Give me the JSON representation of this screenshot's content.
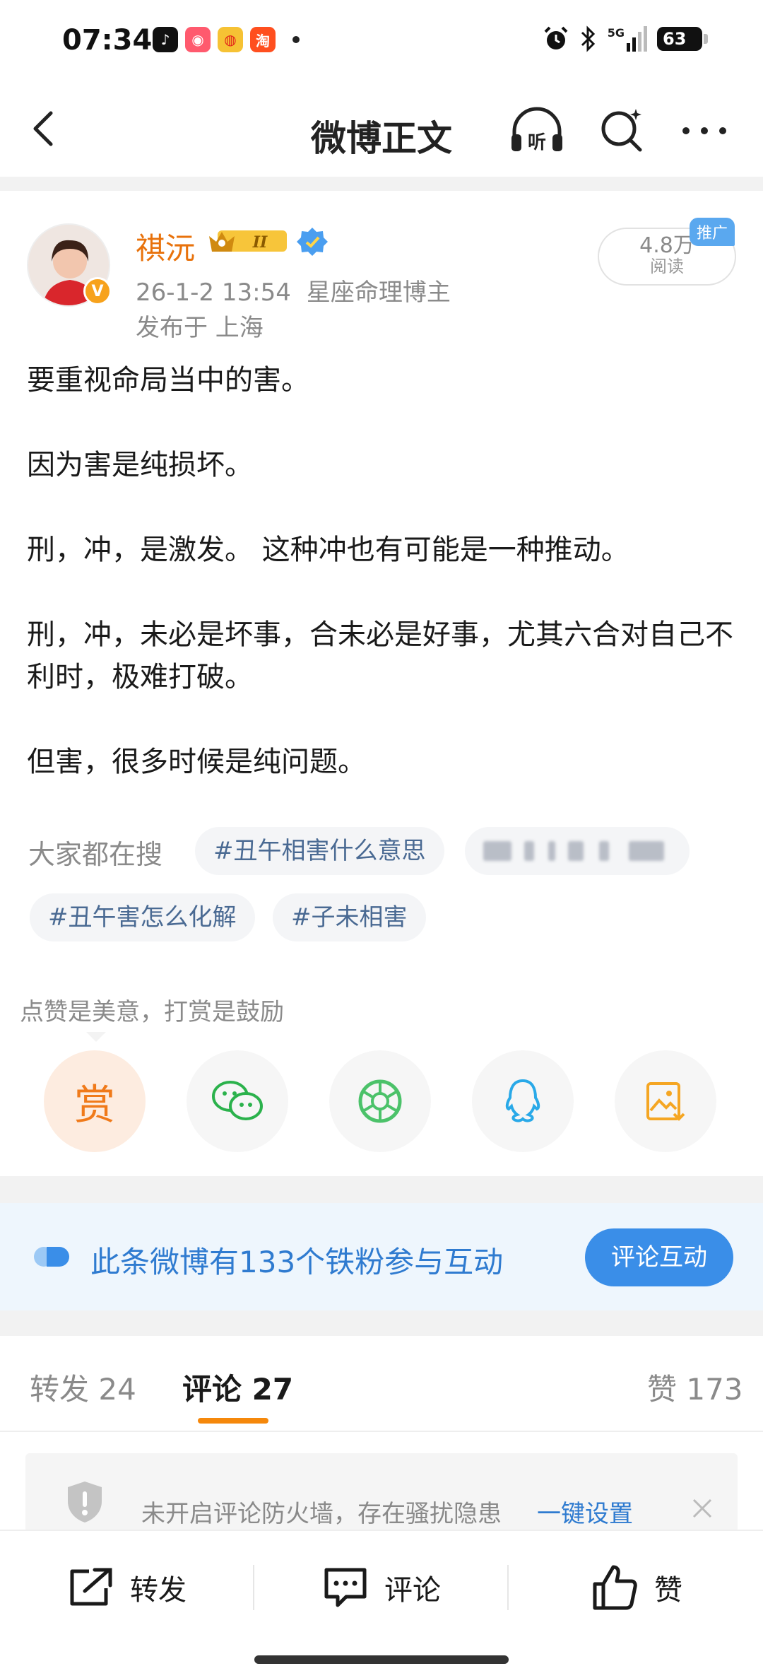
{
  "status_bar": {
    "time": "07:34",
    "network": "5G",
    "battery": "63",
    "app_icons": [
      "douyin-icon",
      "app-icon",
      "weibo-icon",
      "taobao-icon"
    ]
  },
  "nav": {
    "title": "微博正文",
    "listen_label": "听"
  },
  "post": {
    "author": "祺沅",
    "vip_level": "II",
    "date": "26-1-2 13:54",
    "source": "星座命理博主",
    "location": "发布于 上海",
    "read_count": "4.8万",
    "read_label": "阅读",
    "promo_tag": "推广",
    "paragraphs": [
      "要重视命局当中的害。",
      "因为害是纯损坏。",
      "刑，冲，是激发。 这种冲也有可能是一种推动。",
      "刑，冲，未必是坏事，合未必是好事，尤其六合对自己不利时，极难打破。",
      "但害，很多时候是纯问题。"
    ]
  },
  "hot_search": {
    "label": "大家都在搜",
    "tags": [
      "#丑午相害什么意思",
      "#丑午害怎么化解",
      "#子未相害"
    ]
  },
  "reward": {
    "hint": "点赞是美意，打赏是鼓励",
    "reward_label": "赏",
    "share_targets": [
      "wechat-icon",
      "moments-icon",
      "qq-icon",
      "save-image-icon"
    ]
  },
  "fans": {
    "text": "此条微博有133个铁粉参与互动",
    "button": "评论互动"
  },
  "tabs": {
    "repost": "转发 24",
    "comment": "评论 27",
    "like": "赞 173"
  },
  "firewall": {
    "text": "未开启评论防火墙，存在骚扰隐患",
    "link": "一键设置"
  },
  "bottom_bar": {
    "repost": "转发",
    "comment": "评论",
    "like": "赞"
  },
  "colors": {
    "accent_orange": "#f5880b",
    "link_blue": "#2f7bd0",
    "author_orange": "#e8720c"
  }
}
